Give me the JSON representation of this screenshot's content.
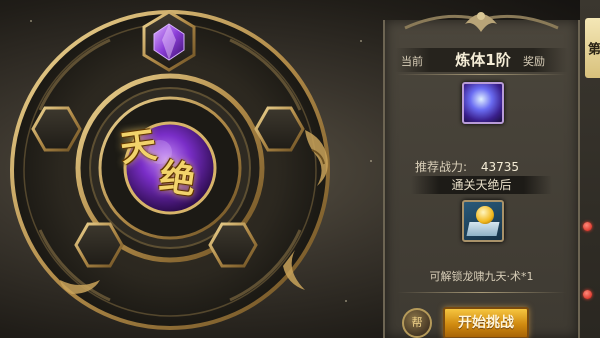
{
  "dial": {
    "title_chars": [
      "天",
      "绝"
    ]
  },
  "panel": {
    "nav": {
      "prev_label": "当前",
      "current_label": "炼体1阶",
      "next_label": "奖励"
    },
    "power": {
      "label": "推荐战力:",
      "value": "43735"
    },
    "clear_label": "通关天绝后",
    "reward_text": "可解锁龙啸九天·术*1",
    "small_button_label": "帮",
    "start_button_label": "开始挑战"
  },
  "side": {
    "tab_label": "第"
  },
  "colors": {
    "accent_gold": "#f2d36b",
    "start_button": "#d08a10",
    "gem_purple": "#8b3dd8"
  },
  "icons": [
    "purple-gem-icon",
    "orb-item-icon",
    "skill-book-icon",
    "dragon-ornament-icon"
  ]
}
